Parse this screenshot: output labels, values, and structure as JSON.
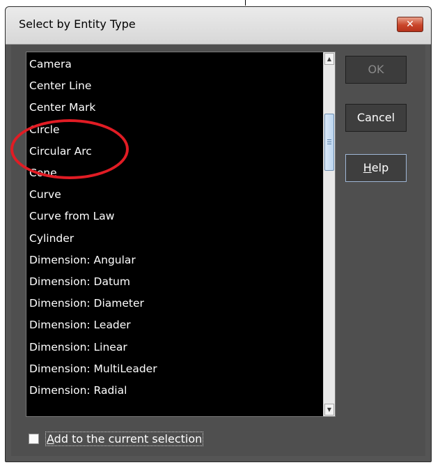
{
  "window": {
    "title": "Select by Entity Type",
    "close_glyph": "✕"
  },
  "list": {
    "items": [
      "Camera",
      "Center Line",
      "Center Mark",
      "Circle",
      "Circular Arc",
      "Cone",
      "Curve",
      "Curve from Law",
      "Cylinder",
      "Dimension: Angular",
      "Dimension: Datum",
      "Dimension: Diameter",
      "Dimension: Leader",
      "Dimension: Linear",
      "Dimension: MultiLeader",
      "Dimension: Radial"
    ]
  },
  "buttons": {
    "ok": "OK",
    "cancel": "Cancel",
    "help_mnemonic": "H",
    "help_rest": "elp"
  },
  "checkbox": {
    "label_mnemonic": "A",
    "label_rest": "dd to the current selection",
    "checked": false
  },
  "scrollbar": {
    "up_glyph": "▲",
    "down_glyph": "▼"
  },
  "colors": {
    "annotation": "#e11c24",
    "list_bg": "#000000",
    "dialog_bg": "#4f4f4f"
  }
}
